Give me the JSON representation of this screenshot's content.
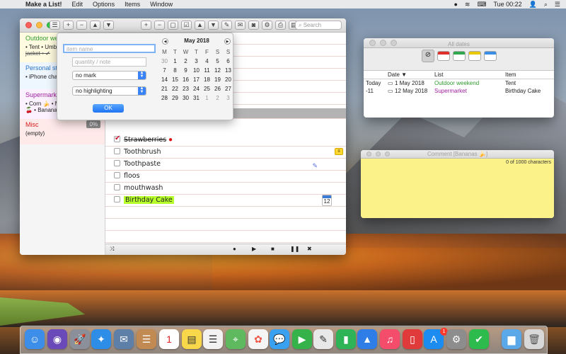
{
  "menubar": {
    "app_name": "Make a List!",
    "menus": [
      "Edit",
      "Options",
      "Items",
      "Window"
    ],
    "clock": "Tue 00:22"
  },
  "main_window": {
    "search_placeholder": "Search",
    "sidebar": {
      "groups": [
        {
          "title": "Outdoor weekend",
          "lines": [
            "• Tent • Umbrella",
            "jacket • ✔"
          ]
        },
        {
          "title": "Personal stuff",
          "lines": [
            "• iPhone charger"
          ]
        },
        {
          "title": "Supermarket",
          "lines": [
            "• Corn 🍌 • M…",
            "🍒 • Bananas"
          ]
        },
        {
          "title": "Misc",
          "badge": "0%",
          "lines": [
            "(empty)"
          ]
        }
      ]
    },
    "items": [
      {
        "label": "Strawberries",
        "checked": true
      },
      {
        "label": "Toothbrush",
        "checked": false
      },
      {
        "label": "Toothpaste",
        "checked": false
      },
      {
        "label": "floos",
        "checked": false
      },
      {
        "label": "mouthwash",
        "checked": false
      },
      {
        "label": "Birthday Cake",
        "checked": false,
        "cal_day": "12"
      }
    ]
  },
  "popover": {
    "item_name_placeholder": "item name",
    "quantity_placeholder": "quantity / note",
    "mark_select": "no mark",
    "highlight_select": "no highlighting",
    "ok_label": "OK",
    "calendar": {
      "month": "May 2018",
      "weekdays": [
        "M",
        "T",
        "W",
        "T",
        "F",
        "S",
        "S"
      ],
      "days": [
        [
          "30",
          "1",
          "2",
          "3",
          "4",
          "5",
          "6"
        ],
        [
          "7",
          "8",
          "9",
          "10",
          "11",
          "12",
          "13"
        ],
        [
          "14",
          "15",
          "16",
          "17",
          "18",
          "19",
          "20"
        ],
        [
          "21",
          "22",
          "23",
          "24",
          "25",
          "26",
          "27"
        ],
        [
          "28",
          "29",
          "30",
          "31",
          "1",
          "2",
          "3"
        ]
      ]
    }
  },
  "dates_window": {
    "title": "All dates",
    "headers": {
      "date": "Date ▼",
      "list": "List",
      "item": "Item"
    },
    "rows": [
      {
        "rel": "Today",
        "date": "1 May 2018",
        "list": "Outdoor weekend",
        "item": "Tent",
        "list_color": "#2f9b2f"
      },
      {
        "rel": "-11",
        "date": "12 May 2018",
        "list": "Supermarket",
        "item": "Birthday Cake",
        "list_color": "#a020a0"
      }
    ],
    "swatch_colors": [
      "#e0302e",
      "#2fa84f",
      "#e8c800",
      "#3a8ee6"
    ]
  },
  "comment_window": {
    "title": "Comment [Bananas 🍌]",
    "char_count": "0 of 1000 characters"
  }
}
